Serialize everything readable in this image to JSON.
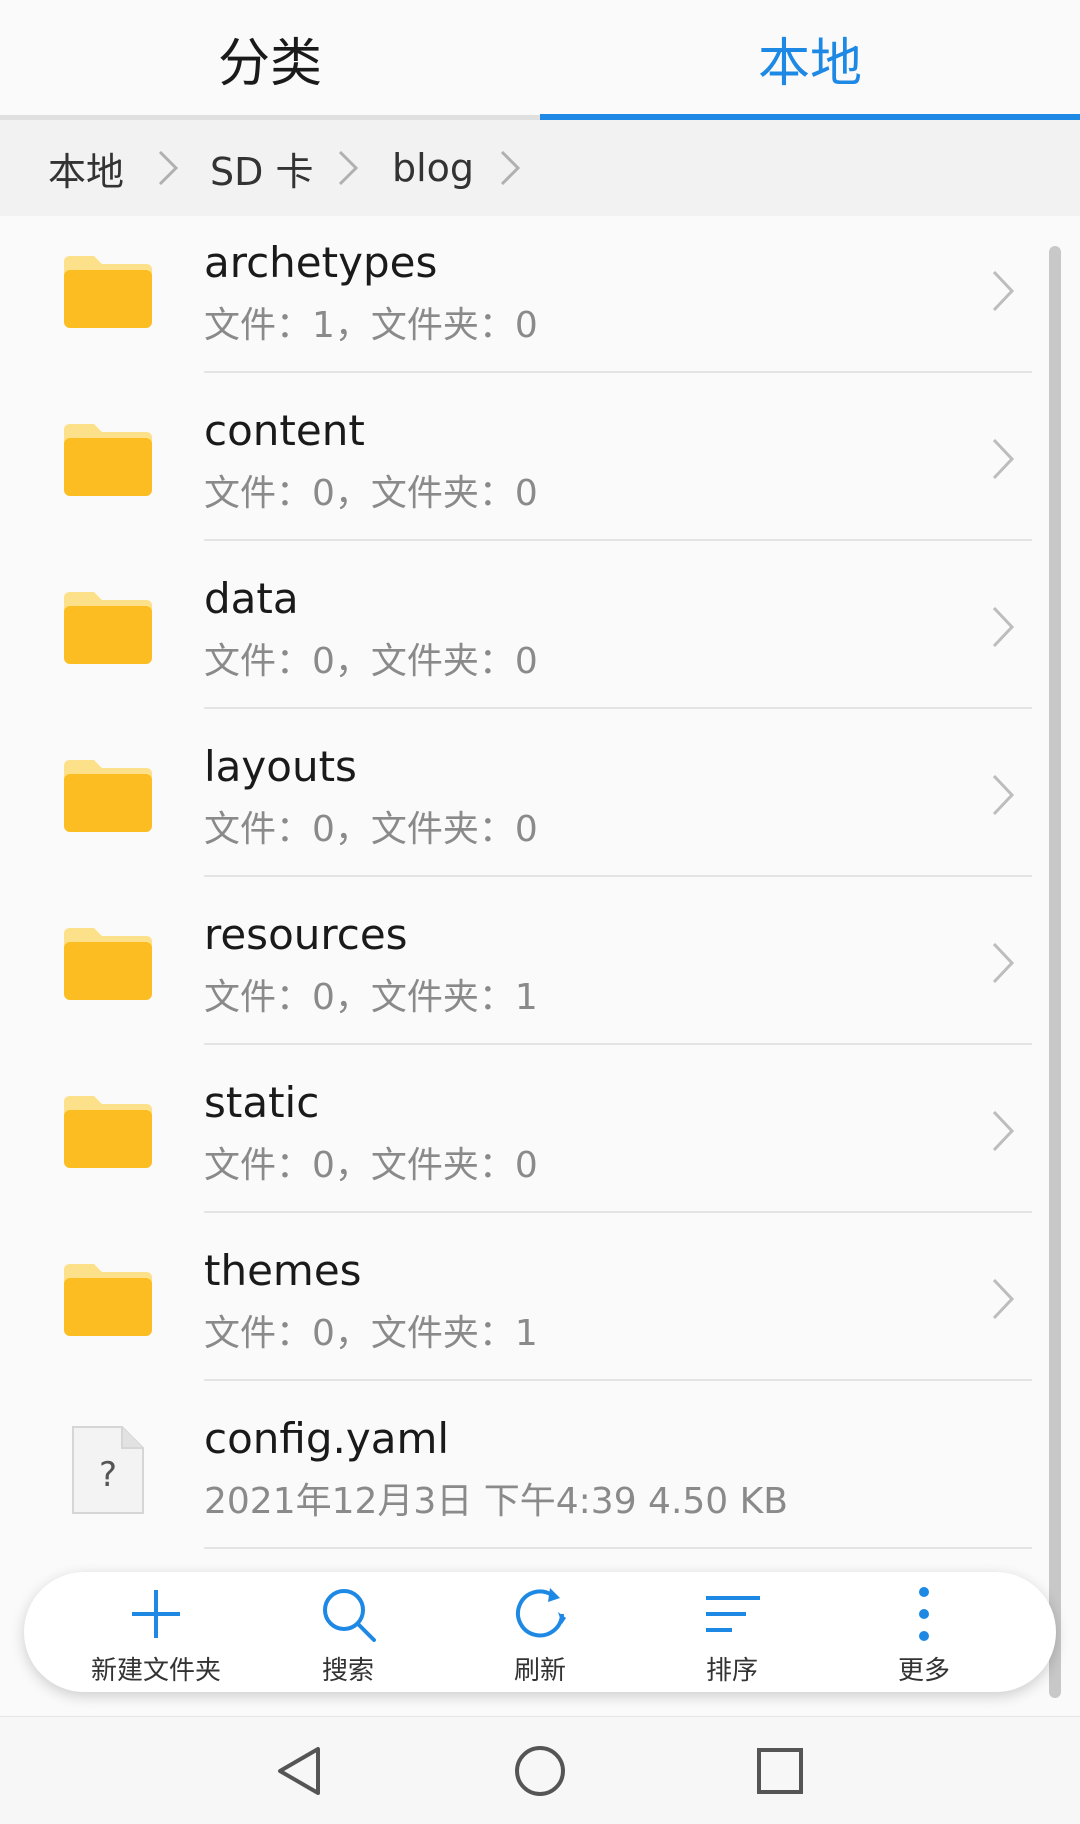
{
  "tabs": [
    {
      "label": "分类",
      "active": false
    },
    {
      "label": "本地",
      "active": true
    }
  ],
  "accent_color": "#1e88e5",
  "breadcrumb": [
    "本地",
    "SD 卡",
    "blog"
  ],
  "files": [
    {
      "name": "archetypes",
      "meta": "文件：1，文件夹：0",
      "type": "folder"
    },
    {
      "name": "content",
      "meta": "文件：0，文件夹：0",
      "type": "folder"
    },
    {
      "name": "data",
      "meta": "文件：0，文件夹：0",
      "type": "folder"
    },
    {
      "name": "layouts",
      "meta": "文件：0，文件夹：0",
      "type": "folder"
    },
    {
      "name": "resources",
      "meta": "文件：0，文件夹：1",
      "type": "folder"
    },
    {
      "name": "static",
      "meta": "文件：0，文件夹：0",
      "type": "folder"
    },
    {
      "name": "themes",
      "meta": "文件：0，文件夹：1",
      "type": "folder"
    },
    {
      "name": "config.yaml",
      "meta": "2021年12月3日 下午4:39 4.50 KB",
      "type": "file"
    }
  ],
  "toolbar": [
    {
      "label": "新建文件夹",
      "icon": "plus-icon"
    },
    {
      "label": "搜索",
      "icon": "search-icon"
    },
    {
      "label": "刷新",
      "icon": "refresh-icon"
    },
    {
      "label": "排序",
      "icon": "sort-icon"
    },
    {
      "label": "更多",
      "icon": "more-vertical-icon"
    }
  ],
  "navbar": [
    "back-icon",
    "home-icon",
    "recents-icon"
  ]
}
